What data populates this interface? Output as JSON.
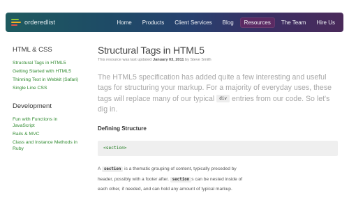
{
  "nav": {
    "logo_text": "orderedlist",
    "logo_bar_colors": [
      "#8fc33a",
      "#f0b323",
      "#e4524a"
    ],
    "items": [
      {
        "label": "Home"
      },
      {
        "label": "Products"
      },
      {
        "label": "Client Services"
      },
      {
        "label": "Blog"
      },
      {
        "label": "Resources",
        "active": true
      },
      {
        "label": "The Team"
      },
      {
        "label": "Hire Us"
      }
    ]
  },
  "sidebar": {
    "section1": {
      "heading": "HTML & CSS",
      "links": [
        "Structural Tags in HTML5",
        "Getting Started with HTML5",
        "Thinning Text in Webkit (Safari)",
        "Single Line CSS"
      ]
    },
    "section2": {
      "heading": "Development",
      "links": [
        "Fun with Functions in JavaScript",
        "Rails & MVC",
        "Class and Instance Methods in Ruby"
      ]
    }
  },
  "article": {
    "title": "Structural Tags in HTML5",
    "updated_prefix": "This resource was last updated",
    "updated_date": "January 03, 2011",
    "updated_by": "by Steve Smith",
    "lead_before": "The HTML5 specification has added quite a few interesting and useful tags for structuring your markup. For a majority of everyday uses, these tags will replace many of our typical",
    "lead_code": "div",
    "lead_after": "entries from our code. So let's dig in.",
    "subheading": "Defining Structure",
    "code_block": "<section>",
    "para_1": "A",
    "para_code1": "section",
    "para_2": "is a thematic grouping of content, typically preceded by header, possibly with a footer after.",
    "para_code2": "section",
    "para_3": "s can be nested inside of each other, if needed, and can hold any amount of typical markup."
  },
  "colors": {
    "accent_link": "#2f8a2f",
    "active_nav": "#5b2a63"
  }
}
